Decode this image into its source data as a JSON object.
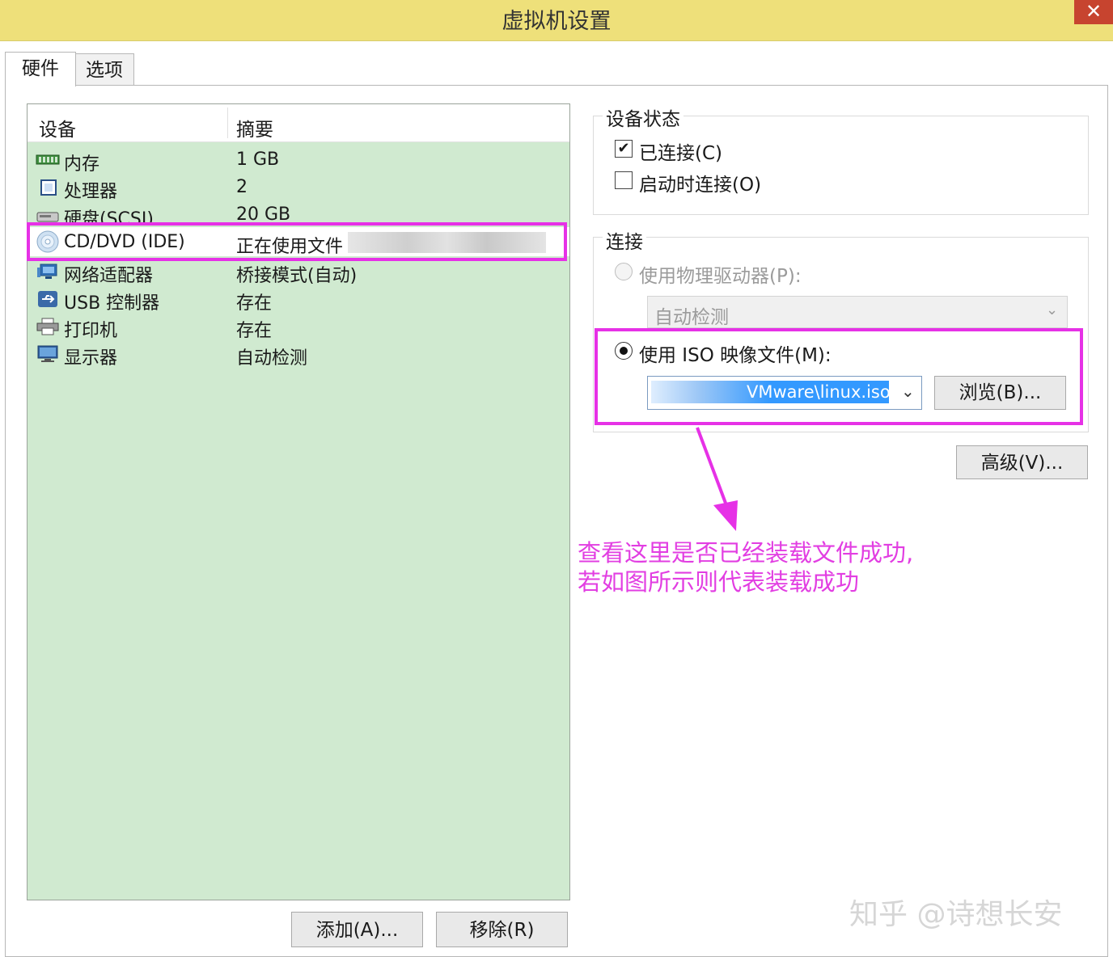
{
  "window": {
    "title": "虚拟机设置",
    "close_glyph": "✕"
  },
  "tabs": [
    {
      "label": "硬件"
    },
    {
      "label": "选项"
    }
  ],
  "device_list": {
    "headers": {
      "device": "设备",
      "summary": "摘要"
    },
    "rows": [
      {
        "name": "内存",
        "summary": "1 GB",
        "icon": "memory-icon"
      },
      {
        "name": "处理器",
        "summary": "2",
        "icon": "processor-icon"
      },
      {
        "name": "硬盘(SCSI)",
        "summary": "20 GB",
        "icon": "hard-disk-icon"
      },
      {
        "name": "CD/DVD (IDE)",
        "summary": "正在使用文件",
        "icon": "cd-dvd-icon",
        "selected": true
      },
      {
        "name": "网络适配器",
        "summary": "桥接模式(自动)",
        "icon": "network-adapter-icon"
      },
      {
        "name": "USB 控制器",
        "summary": "存在",
        "icon": "usb-icon"
      },
      {
        "name": "打印机",
        "summary": "存在",
        "icon": "printer-icon"
      },
      {
        "name": "显示器",
        "summary": "自动检测",
        "icon": "monitor-icon"
      }
    ]
  },
  "device_status": {
    "label": "设备状态",
    "connected": {
      "label": "已连接(C)",
      "checked": true
    },
    "connect_at_power_on": {
      "label": "启动时连接(O)",
      "checked": false
    }
  },
  "connection": {
    "label": "连接",
    "physical_drive": {
      "label": "使用物理驱动器(P):",
      "selected": false,
      "dropdown_value": "自动检测"
    },
    "iso_image": {
      "label": "使用 ISO 映像文件(M):",
      "selected": true,
      "path_value": "VMware\\linux.iso"
    },
    "browse_button": "浏览(B)..."
  },
  "advanced_button": "高级(V)...",
  "add_button": "添加(A)...",
  "remove_button": "移除(R)",
  "annotation": {
    "line1": "查看这里是否已经装载文件成功,",
    "line2": "若如图所示则代表装载成功"
  },
  "watermark": "知乎 @诗想长安",
  "colors": {
    "titlebar": "#eee07a",
    "list_bg": "#d0ead0",
    "highlight": "#e631e6",
    "selection": "#3399ff"
  }
}
